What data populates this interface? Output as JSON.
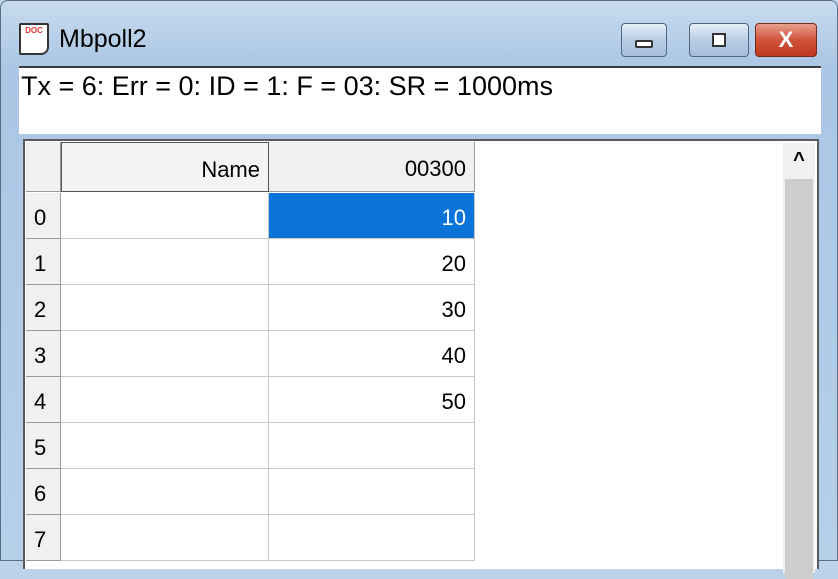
{
  "window": {
    "title": "Mbpoll2",
    "icon": "doc-icon",
    "icon_text": "DOC"
  },
  "controls": {
    "minimize": "minimize-icon",
    "maximize": "restore-icon",
    "close_label": "X"
  },
  "status": "Tx = 6: Err = 0: ID = 1: F = 03: SR = 1000ms",
  "grid": {
    "headers": {
      "name": "Name",
      "address": "00300"
    },
    "rows": [
      {
        "index": "0",
        "name": "",
        "value": "10",
        "selected": true
      },
      {
        "index": "1",
        "name": "",
        "value": "20"
      },
      {
        "index": "2",
        "name": "",
        "value": "30"
      },
      {
        "index": "3",
        "name": "",
        "value": "40"
      },
      {
        "index": "4",
        "name": "",
        "value": "50"
      },
      {
        "index": "5",
        "name": "",
        "value": ""
      },
      {
        "index": "6",
        "name": "",
        "value": ""
      },
      {
        "index": "7",
        "name": "",
        "value": ""
      }
    ],
    "selection_color": "#0a74d8"
  },
  "scrollbar": {
    "up_arrow": "^"
  }
}
